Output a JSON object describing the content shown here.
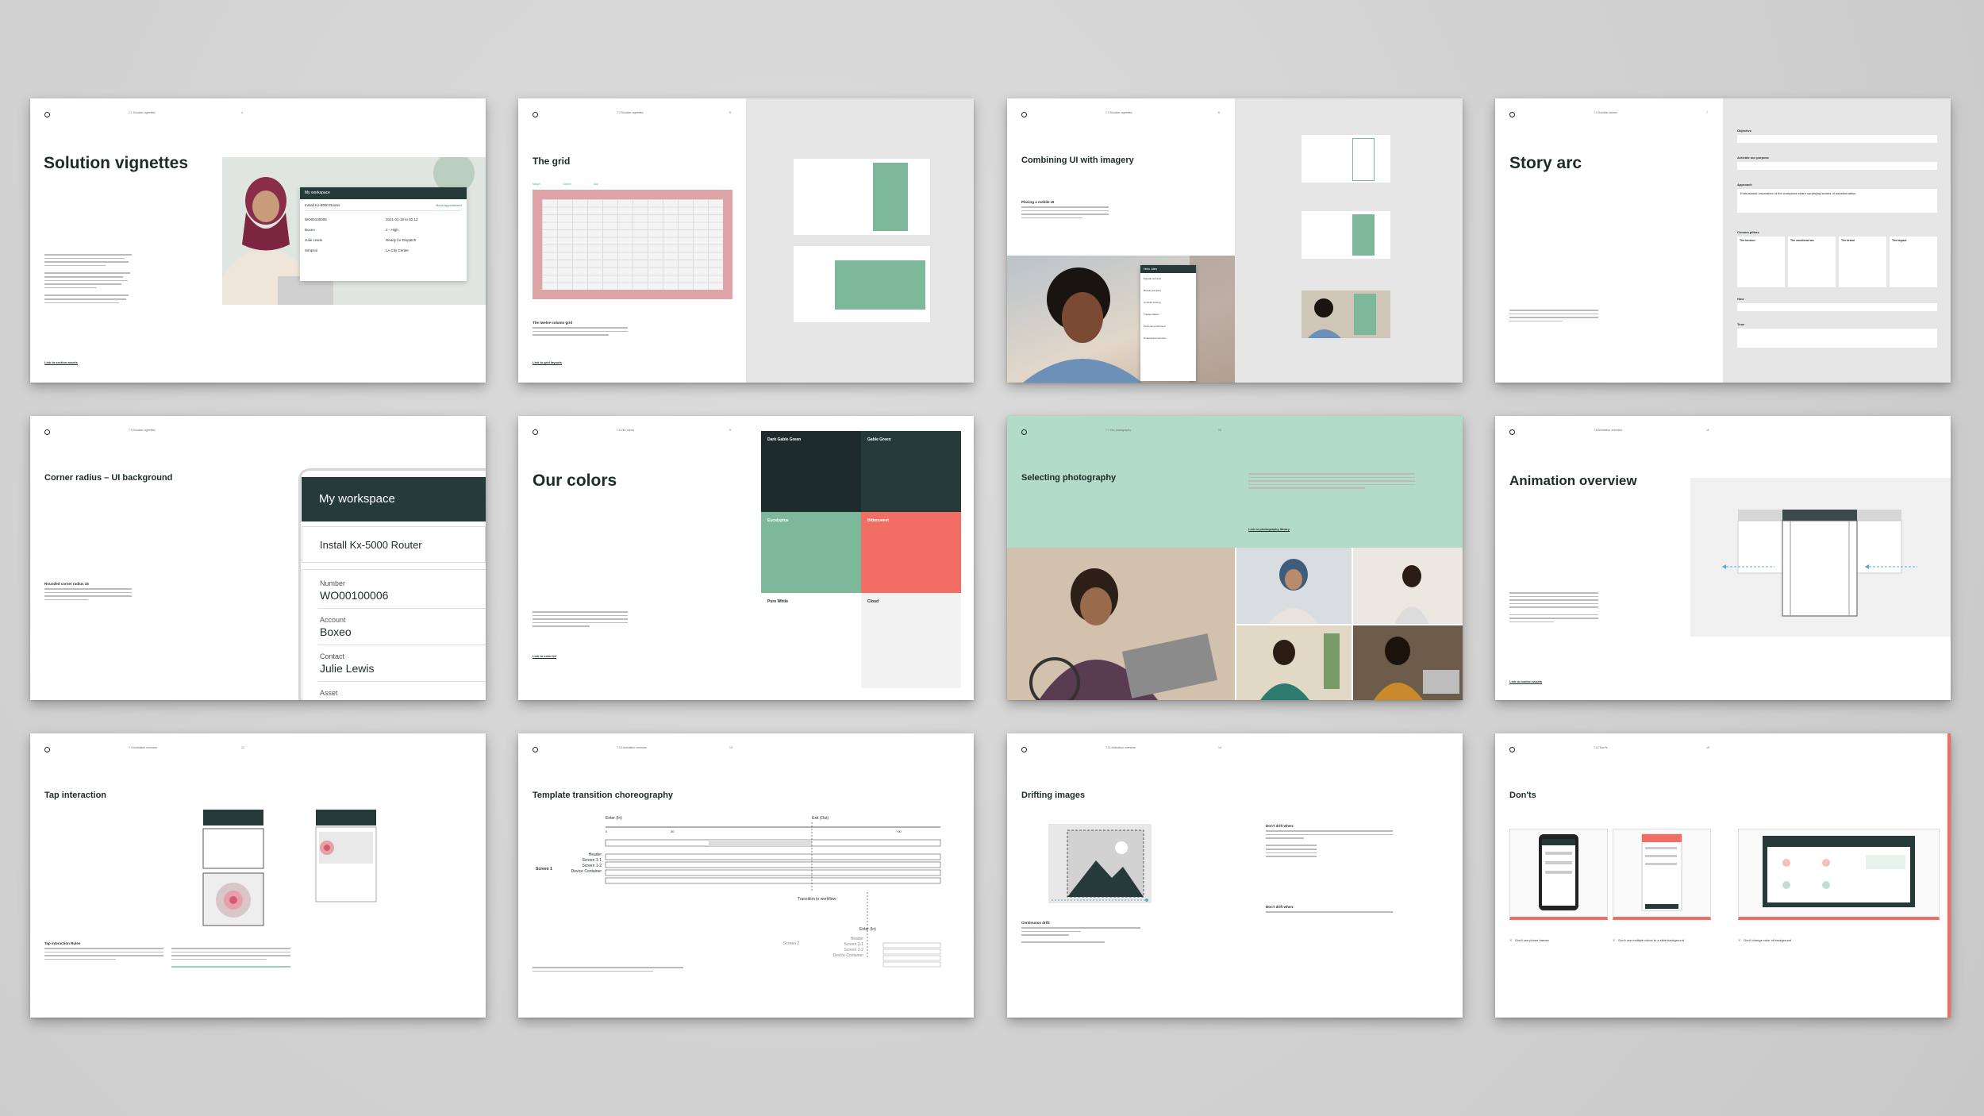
{
  "slides": {
    "s1": {
      "header": "7.1 Solution vignettes",
      "page": "4",
      "title": "Solution vignettes",
      "link": "Link to section assets",
      "card_title": "My workspace",
      "card_row": "Install Kx-5000 Router",
      "card_action": "Book Appointment",
      "fields": [
        [
          "WO00100006",
          "2021-01-18 to 02:12"
        ],
        [
          "Boxeo",
          "2 - High"
        ],
        [
          "Julie Lewis",
          "Ready for Dispatch"
        ],
        [
          "Simpsol",
          "LA City Center"
        ]
      ]
    },
    "s2": {
      "header": "7.2 Solution vignettes",
      "page": "5",
      "title": "The grid",
      "subtitle": "The twelve column grid",
      "link": "Link to grid layouts",
      "labels": [
        "Margin",
        "Column",
        "Gap"
      ]
    },
    "s3": {
      "header": "7.3 Solution vignettes",
      "page": "6",
      "title": "Combining UI with imagery",
      "subtitle": "Placing a mobile UI",
      "menu": [
        "Hello Jules",
        "Popular services",
        "Browse services",
        "Contract closing",
        "Transportation",
        "Personal enrichment",
        "Professional services"
      ]
    },
    "s4": {
      "header": "7.4 Solution stories",
      "page": "7",
      "title": "Story arc",
      "labels": [
        "Objective",
        "Activate our purpose",
        "Approach",
        "Comms pillars",
        "How",
        "Tone"
      ],
      "approach": "Enthusiastic visionaries of the workplace share surprising stories of transformation",
      "pillars": [
        "The tension",
        "The emotional arc",
        "The brand",
        "The impact"
      ]
    },
    "s5": {
      "header": "7.5 Solution vignettes",
      "page": "8",
      "title": "Corner radius – UI background",
      "subtitle": "Rounded corner radius 15",
      "workspace": "My workspace",
      "row": "Install Kx-5000 Router",
      "fields": [
        {
          "label": "Number",
          "value": "WO00100006"
        },
        {
          "label": "Account",
          "value": "Boxeo"
        },
        {
          "label": "Contact",
          "value": "Julie Lewis"
        },
        {
          "label": "Asset",
          "value": ""
        }
      ]
    },
    "s6": {
      "header": "7.6 Our colors",
      "page": "9",
      "title": "Our colors",
      "link": "Link to color kit",
      "colors": [
        {
          "name": "Dark Gable Green",
          "hex": "#1d2b2a",
          "text": "#ffffff"
        },
        {
          "name": "Gable Green",
          "hex": "#263a3a",
          "text": "#ffffff"
        },
        {
          "name": "Eucalyptus",
          "hex": "#7db89a",
          "text": "#ffffff"
        },
        {
          "name": "Bittersweet",
          "hex": "#f26d63",
          "text": "#ffffff"
        },
        {
          "name": "Pure White",
          "hex": "#ffffff",
          "text": "#1e2b2a"
        },
        {
          "name": "Cloud",
          "hex": "#f2f2f2",
          "text": "#1e2b2a"
        }
      ]
    },
    "s7": {
      "header": "7.7 Our photography",
      "page": "10",
      "title": "Selecting photography",
      "link": "Link to photography library"
    },
    "s8": {
      "header": "7.8 Animation overview",
      "page": "11",
      "title": "Animation overview",
      "link": "Link to motion assets"
    },
    "s9": {
      "header": "7.9 Animation overview",
      "page": "12",
      "title": "Tap interaction",
      "subtitle": "Tap interaction Rules"
    },
    "s10": {
      "header": "7.10 Animation overview",
      "page": "13",
      "title": "Template transition choreography",
      "labels": [
        "Enter (In)",
        "Exit (Out)",
        "Screen 1",
        "Header",
        "Screen 1-1",
        "Screen 1-2",
        "Device Container",
        "Transition to workflow:",
        "Enter (In)",
        "Screen 2",
        "Header",
        "Screen 2-1",
        "Screen 2-2",
        "Device Container"
      ],
      "ticks": [
        "0",
        "30",
        "+30"
      ]
    },
    "s11": {
      "header": "7.11 Animation overview",
      "page": "14",
      "title": "Drifting images",
      "subtitle": "Continuous drift:",
      "dont1": "Don't drift when:",
      "dont2": "Don't drift when:"
    },
    "s12": {
      "header": "7.12 Don'ts",
      "page": "15",
      "title": "Don'ts",
      "captions": [
        "Don't use phone frames",
        "Don't use multiple colors to a slide background",
        "Don't change color of background"
      ]
    }
  },
  "colors": {
    "dark": "#1e2b2a",
    "green": "#7db89a",
    "coral": "#f26d63",
    "mint": "#b2dcc8",
    "pink": "#dfa4a8"
  }
}
